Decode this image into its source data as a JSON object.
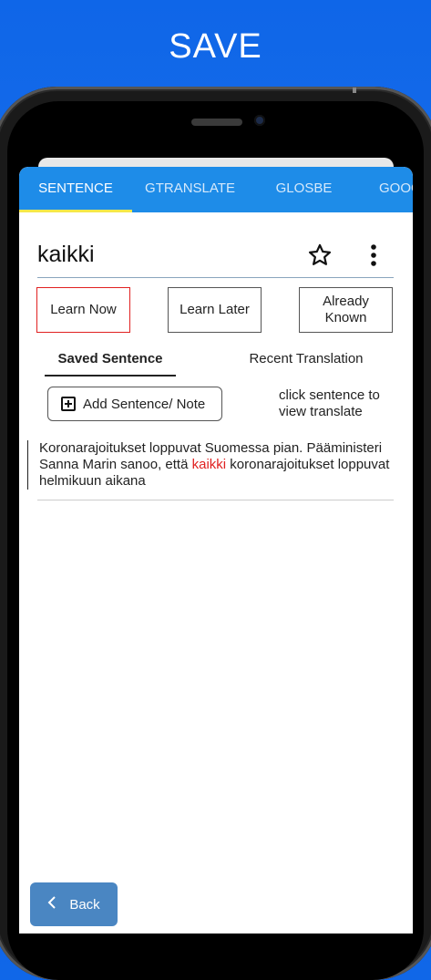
{
  "promo": {
    "title": "SAVE"
  },
  "tabs": [
    {
      "label": "SENTENCE"
    },
    {
      "label": "GTRANSLATE"
    },
    {
      "label": "GLOSBE"
    },
    {
      "label": "GOOG"
    }
  ],
  "word": {
    "text": "kaikki",
    "favorite_icon": "star-outline-icon",
    "menu_icon": "more-vertical-icon"
  },
  "learning_status": {
    "buttons": [
      {
        "label": "Learn Now",
        "selected": true
      },
      {
        "label": "Learn Later",
        "selected": false
      },
      {
        "label": "Already Known",
        "selected": false
      }
    ],
    "selected_color": "#e02020"
  },
  "subtabs": [
    {
      "label": "Saved Sentence",
      "active": true
    },
    {
      "label": "Recent Translation",
      "active": false
    }
  ],
  "add_sentence": {
    "label": "Add Sentence/ Note",
    "icon": "plus-square-icon"
  },
  "hint": "click sentence to view translate",
  "sentences": [
    {
      "before": "Koronarajoitukset loppuvat Suomessa pian. Pääministeri Sanna Marin sanoo, että ",
      "highlight": "kaikki",
      "after": " koronarajoitukset loppuvat helmikuun aikana"
    }
  ],
  "back": {
    "label": "Back",
    "icon": "chevron-left-icon"
  },
  "colors": {
    "accent": "#1e8ce8",
    "tab_indicator": "#f6e84a",
    "background": "#0f66e8",
    "back_button": "#4a86c2"
  }
}
